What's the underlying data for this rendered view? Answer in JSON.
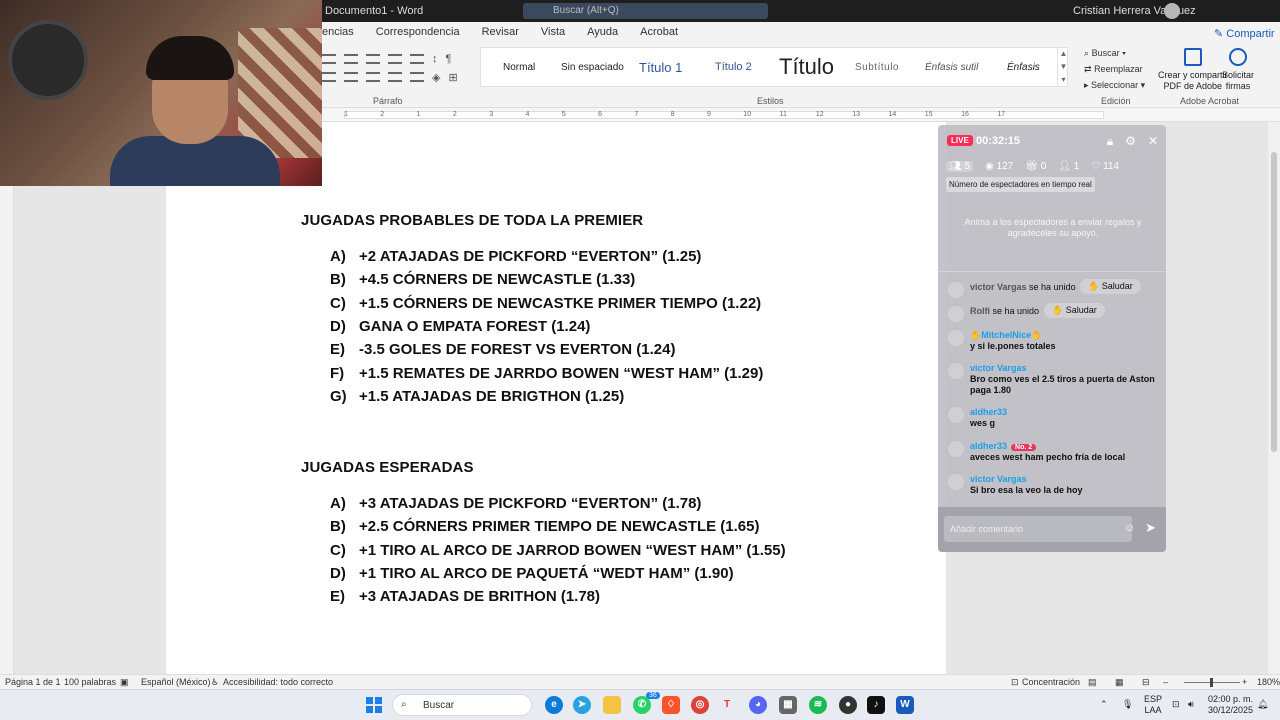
{
  "titlebar": {
    "doc_fragment": "Documento1  -  Word",
    "search_placeholder": "Buscar (Alt+Q)",
    "user": "Cristian Herrera Vasquez"
  },
  "ribbon": {
    "tabs": [
      "encias",
      "Correspondencia",
      "Revisar",
      "Vista",
      "Ayuda",
      "Acrobat"
    ],
    "share": "Compartir",
    "group_parrafo": "Párrafo",
    "group_estilos": "Estilos",
    "group_edicion": "Edición",
    "group_adobe": "Adobe Acrobat",
    "styles": [
      "Normal",
      "Sin espaciado",
      "Título 1",
      "Título 2",
      "Título",
      "Subtítulo",
      "Énfasis sutil",
      "Énfasis"
    ],
    "edit": {
      "buscar": "Buscar",
      "reemplazar": "Reemplazar",
      "seleccionar": "Seleccionar"
    },
    "adobe": {
      "crear": [
        "Crear y compartir",
        "PDF de Adobe"
      ],
      "solicitar": [
        "Solicitar",
        "firmas"
      ]
    }
  },
  "ruler_ticks": [
    "1",
    "2",
    "1",
    "2",
    "3",
    "4",
    "5",
    "6",
    "7",
    "8",
    "9",
    "10",
    "11",
    "12",
    "13",
    "14",
    "15",
    "16",
    "17"
  ],
  "document": {
    "heading1": "JUGADAS PROBABLES DE TODA LA PREMIER",
    "list1": [
      {
        "marker": "A)",
        "text": "+2 ATAJADAS DE PICKFORD “EVERTON” (1.25)"
      },
      {
        "marker": "B)",
        "text": "+4.5 CÓRNERS DE NEWCASTLE (1.33)"
      },
      {
        "marker": "C)",
        "text": "+1.5 CÓRNERS DE NEWCASTKE PRIMER TIEMPO (1.22)"
      },
      {
        "marker": "D)",
        "text": "GANA O EMPATA FOREST (1.24)"
      },
      {
        "marker": "E)",
        "text": "-3.5 GOLES DE FOREST VS EVERTON (1.24)"
      },
      {
        "marker": "F)",
        "text": "+1.5 REMATES DE JARRDO BOWEN “WEST HAM” (1.29)"
      },
      {
        "marker": "G)",
        "text": "+1.5 ATAJADAS DE BRIGTHON (1.25)"
      }
    ],
    "heading2": "JUGADAS ESPERADAS",
    "list2": [
      {
        "marker": "A)",
        "text": "+3 ATAJADAS DE PICKFORD “EVERTON” (1.78)"
      },
      {
        "marker": "B)",
        "text": "+2.5 CÓRNERS PRIMER TIEMPO DE NEWCASTLE (1.65)"
      },
      {
        "marker": "C)",
        "text": "+1 TIRO AL ARCO DE JARROD BOWEN “WEST HAM” (1.55)"
      },
      {
        "marker": "D)",
        "text": "+1 TIRO AL ARCO DE PAQUETÁ “WEDT HAM” (1.90)"
      },
      {
        "marker": "E)",
        "text": "+3 ATAJADAS DE BRITHON (1.78)"
      }
    ]
  },
  "live": {
    "badge": "LIVE",
    "timer": "00:32:15",
    "stats": {
      "viewers_now": "5",
      "views": "127",
      "gifts": "0",
      "new_followers": "1",
      "likes": "114"
    },
    "tooltip": "Número de espectadores en tiempo real",
    "hint": "Anima a los espectadores a enviar regalos y agradéceles su apoyo.",
    "messages": [
      {
        "type": "join",
        "name": "victor Vargas",
        "text": "se ha unido",
        "action": "Saludar"
      },
      {
        "type": "join",
        "name": "Rolfi",
        "text": "se ha unido",
        "action": "Saludar"
      },
      {
        "type": "chat",
        "name": "✋MitchelNice✋",
        "text": "y si le.pones totales"
      },
      {
        "type": "chat",
        "name": "victor Vargas",
        "text": "Bro como ves el 2.5 tiros a puerta de Aston paga 1.80"
      },
      {
        "type": "chat",
        "name": "aldher33",
        "text": "wes g"
      },
      {
        "type": "chat",
        "name": "aldher33",
        "badge": "No. 2",
        "text": "aveces west ham pecho fría de local"
      },
      {
        "type": "chat",
        "name": "victor Vargas",
        "text": "Si bro esa la veo la de hoy"
      }
    ],
    "input_placeholder": "Añadir comentario"
  },
  "statusbar": {
    "page": "Página 1 de 1",
    "words": "100 palabras",
    "language": "Español (México)",
    "accessibility": "Accesibilidad: todo correcto",
    "focus": "Concentración",
    "zoom": "180%"
  },
  "taskbar": {
    "search": "Buscar",
    "whatsapp_badge": "36",
    "lang": [
      "ESP",
      "LAA"
    ],
    "time": "02:00 p. m.",
    "date": "30/12/2025"
  }
}
